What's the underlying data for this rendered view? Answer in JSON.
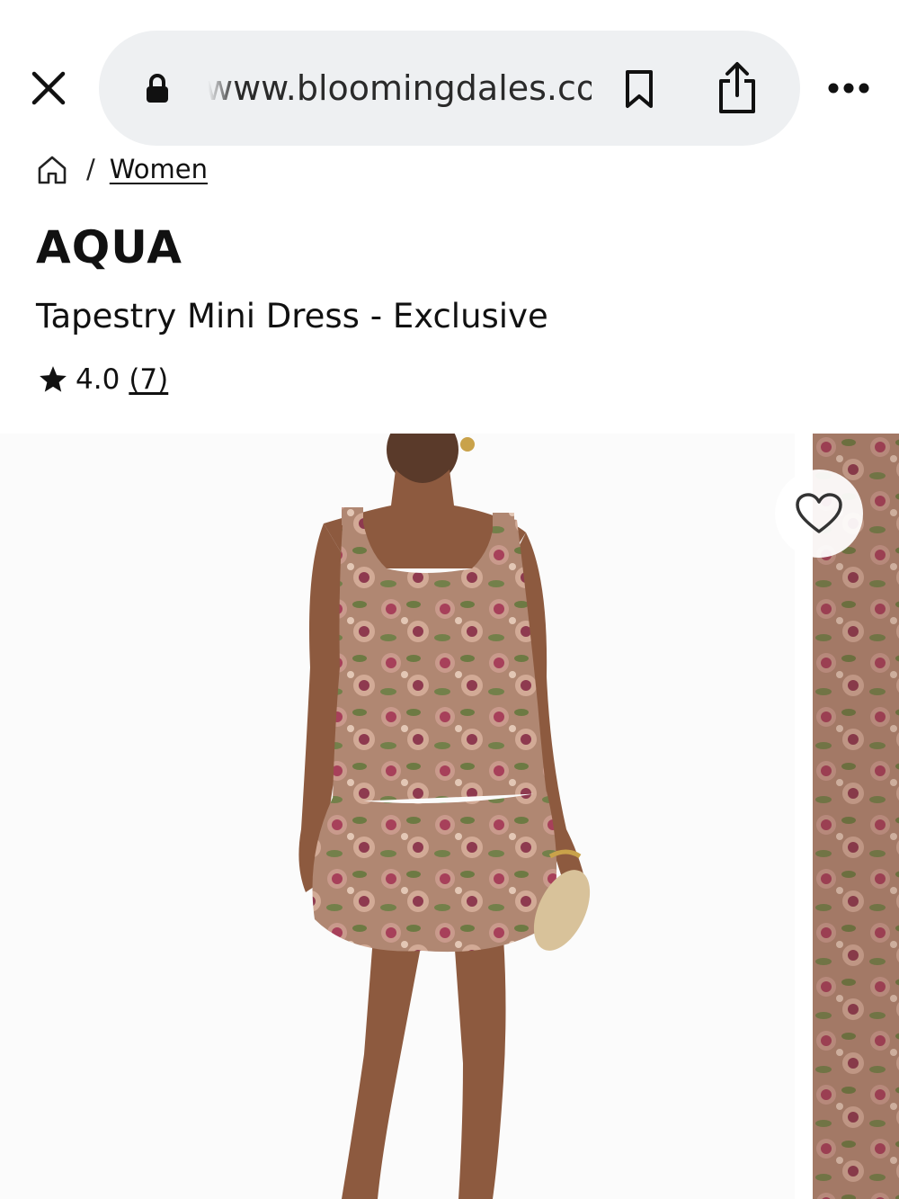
{
  "browser": {
    "url": "www.bloomingdales.com",
    "icons": {
      "close": "close-icon",
      "lock": "lock-icon",
      "bookmark": "bookmark-icon",
      "share": "share-icon",
      "more": "more-icon"
    }
  },
  "breadcrumb": {
    "separator": "/",
    "current": "Women"
  },
  "product": {
    "brand": "AQUA",
    "name": "Tapestry Mini Dress - Exclusive",
    "rating": "4.0",
    "review_count": "(7)"
  },
  "gallery": {
    "icons": {
      "favorite": "heart-icon"
    }
  },
  "colors": {
    "url_pill": "#eef0f2",
    "text": "#111111",
    "skin": "#8d5a3f",
    "dress_base": "#b08772",
    "dress_rose": "#a7405a",
    "dress_leaf": "#6d7a43"
  }
}
